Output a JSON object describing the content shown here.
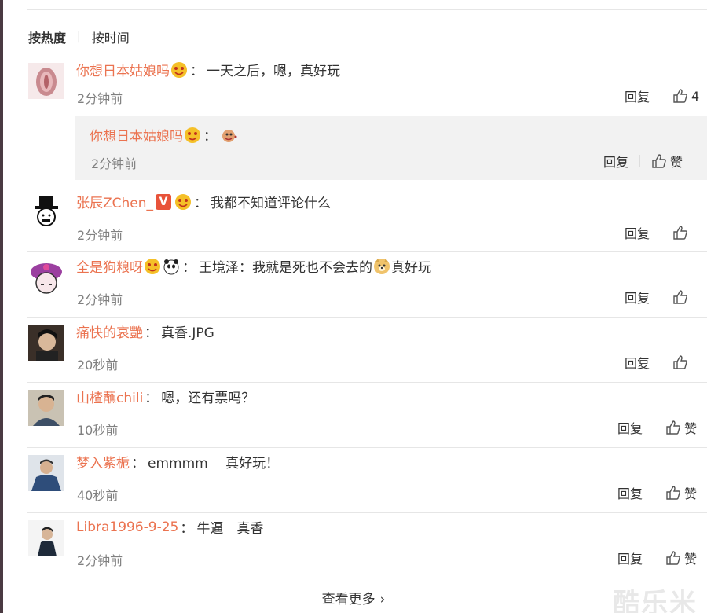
{
  "sort": {
    "hot": "按热度",
    "time": "按时间"
  },
  "labels": {
    "reply": "回复",
    "like": "赞"
  },
  "comments": [
    {
      "user": "你想日本姑娘吗",
      "text": "一天之后，嗯，真好玩",
      "time": "2分钟前",
      "like_label": "4"
    },
    {
      "user": "张辰ZChen_",
      "text": "我都不知道评论什么",
      "time": "2分钟前"
    },
    {
      "user": "全是狗粮呀",
      "text_a": "王境泽：我就是死也不会去的",
      "text_b": "真好玩",
      "time": "2分钟前"
    },
    {
      "user": "痛快的哀艷",
      "text": "真香.JPG",
      "time": "20秒前"
    },
    {
      "user": "山楂蘸chili",
      "text": "嗯，还有票吗？",
      "time": "10秒前"
    },
    {
      "user": "梦入紫栀",
      "text": "emmmm　 真好玩！",
      "time": "40秒前"
    },
    {
      "user": "Libra1996-9-25",
      "text": "牛逼　真香",
      "time": "2分钟前"
    }
  ],
  "sub_reply": {
    "user": "你想日本姑娘吗",
    "time": "2分钟前"
  },
  "more": {
    "label": "查看更多"
  },
  "watermark": "酷乐米",
  "colors": {
    "username": "#eb7350",
    "time": "#808080",
    "sub_bg": "#f2f2f2"
  }
}
